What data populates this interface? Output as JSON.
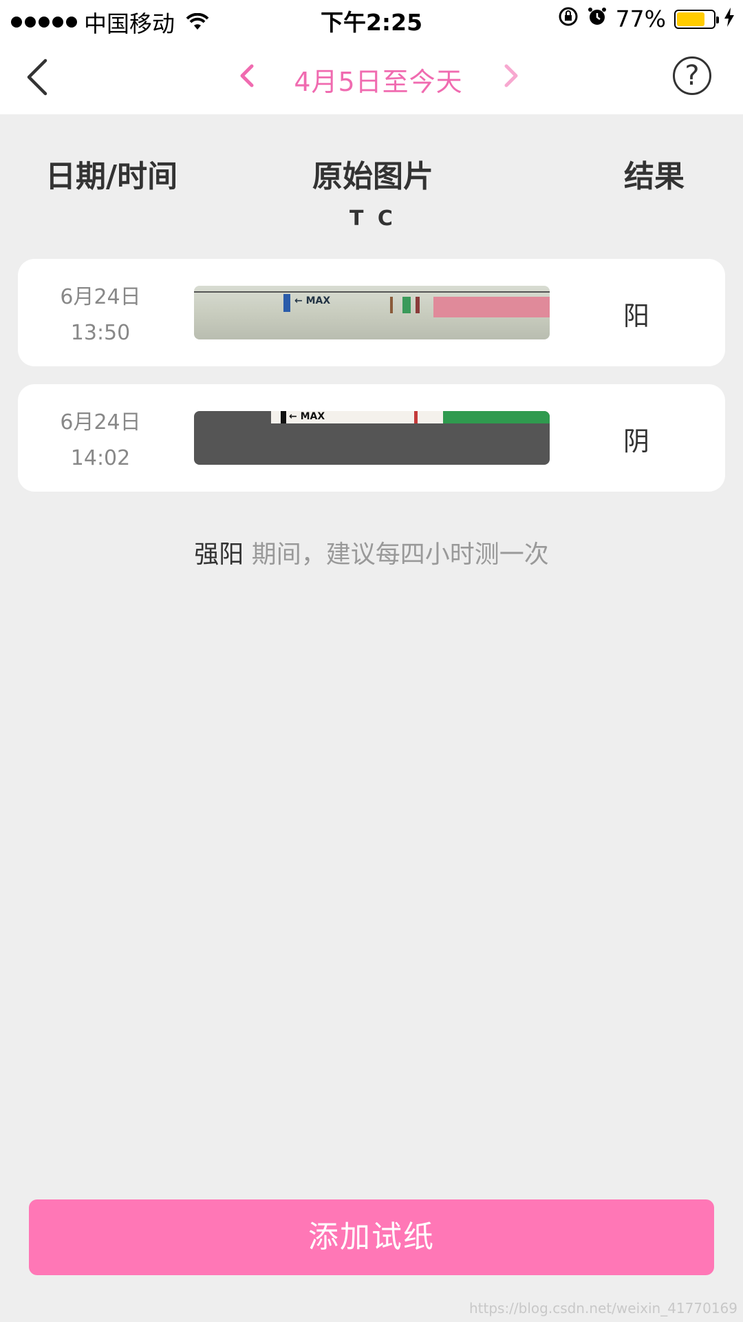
{
  "status_bar": {
    "carrier": "中国移动",
    "time": "下午2:25",
    "battery_percent": "77%",
    "battery_level": 0.77,
    "battery_color": "#ffcc00"
  },
  "nav": {
    "title": "4月5日至今天",
    "accent_color": "#f06bb0"
  },
  "table": {
    "headers": {
      "date": "日期/时间",
      "image": "原始图片",
      "result": "结果"
    },
    "tc_labels": "T C",
    "rows": [
      {
        "date": "6月24日",
        "time": "13:50",
        "strip_text": "MAX",
        "result": "阳"
      },
      {
        "date": "6月24日",
        "time": "14:02",
        "strip_text": "MAX",
        "result": "阴"
      }
    ]
  },
  "tip": {
    "strong": "强阳",
    "text": "期间，建议每四小时测一次"
  },
  "add_button": {
    "label": "添加试纸",
    "color": "#ff77b6"
  },
  "watermark": "https://blog.csdn.net/weixin_41770169"
}
